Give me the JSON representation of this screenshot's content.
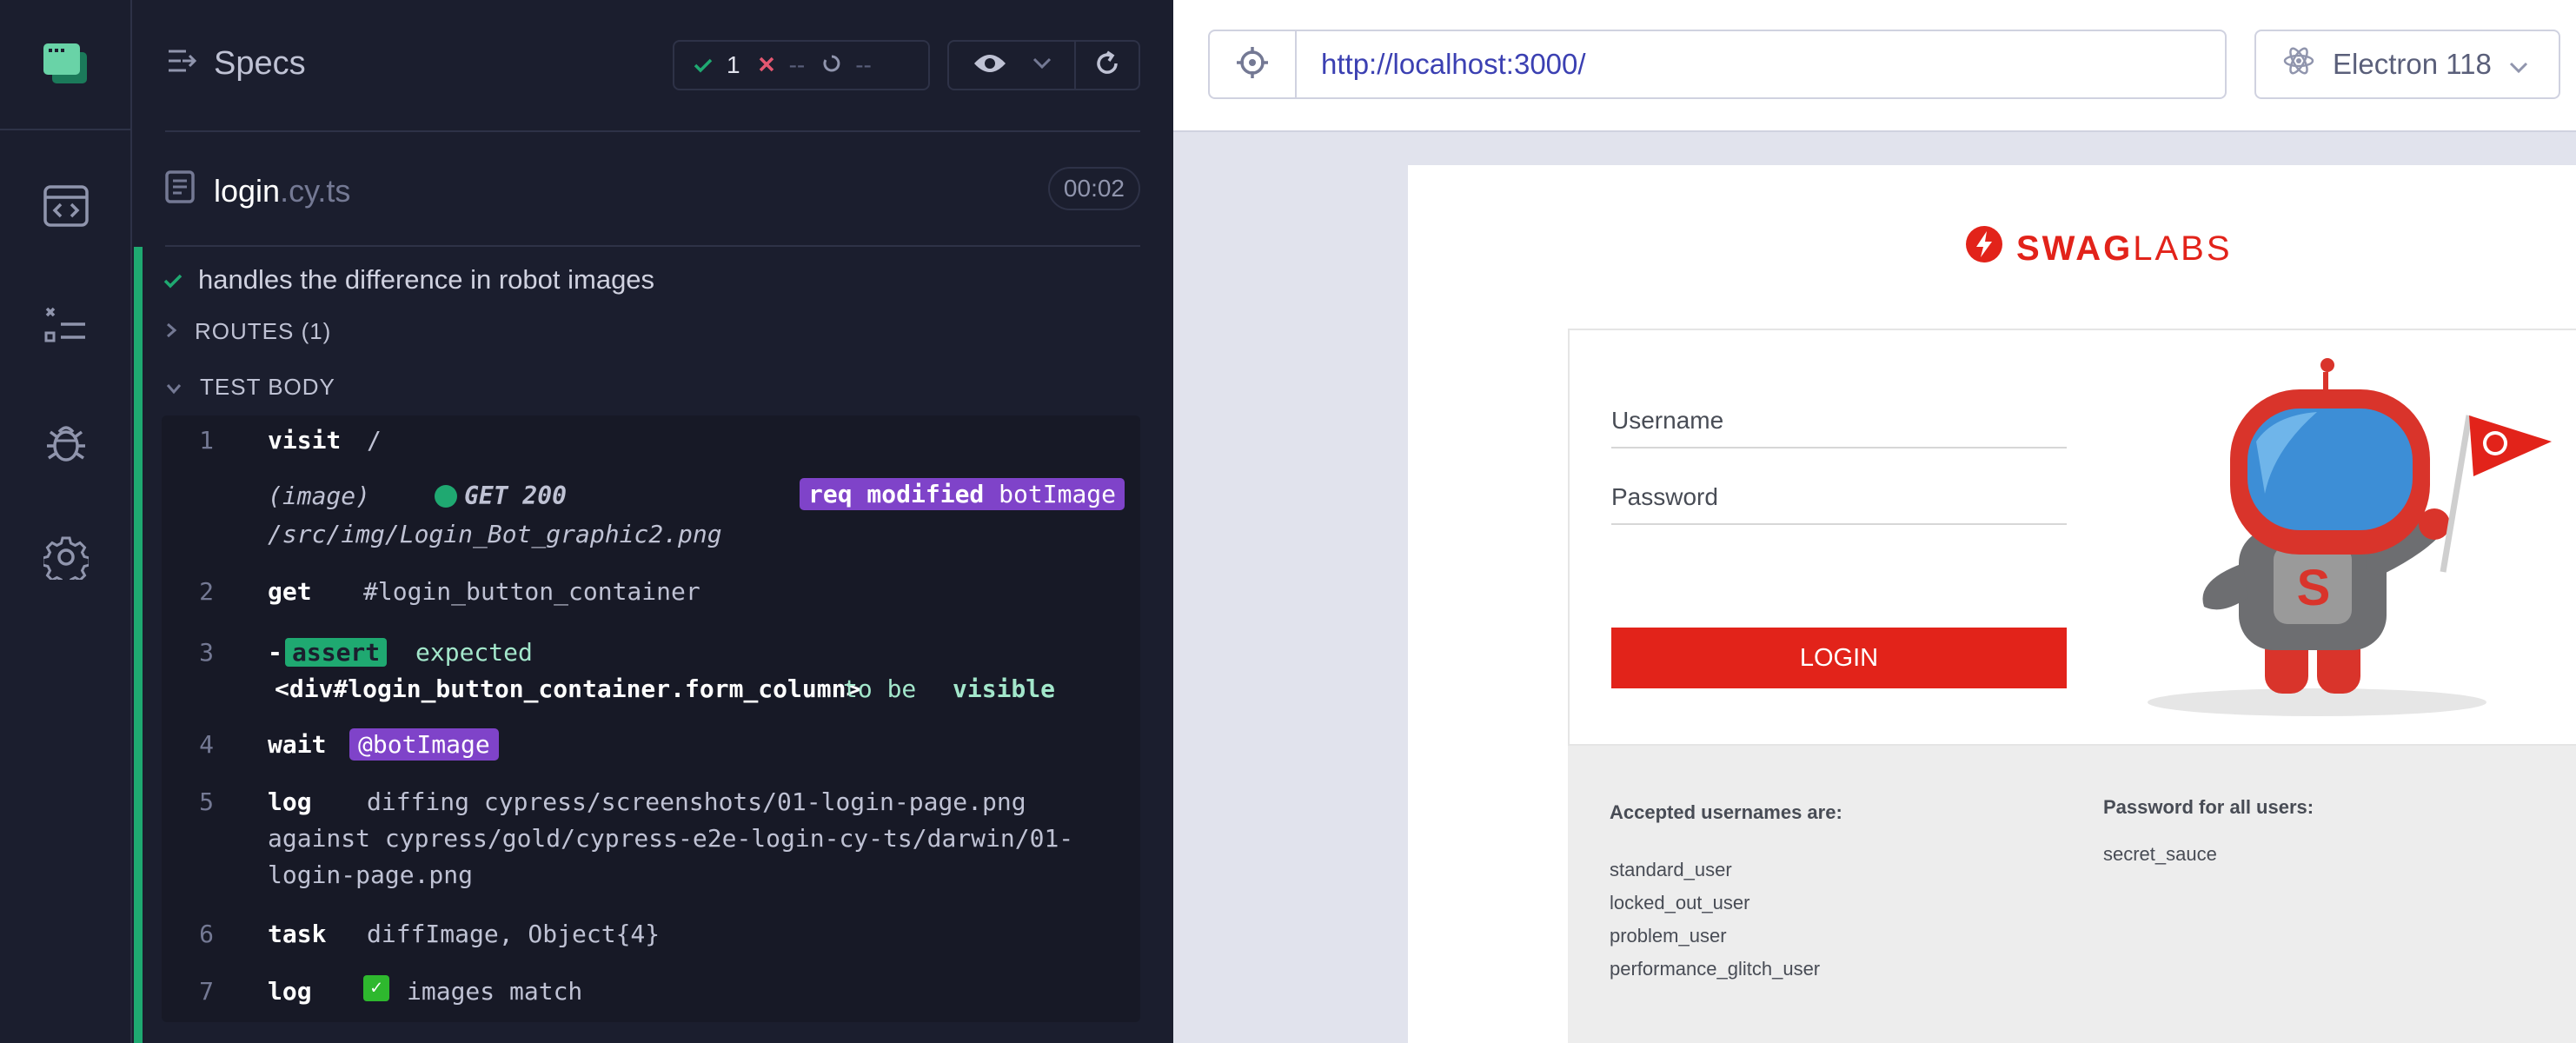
{
  "specs_panel": {
    "title": "Specs",
    "stats": {
      "passed": "1",
      "failed": "--",
      "pending": "--"
    },
    "file": {
      "name": "login",
      "ext": ".cy.ts",
      "duration": "00:02"
    },
    "test_title": "handles the difference in robot images",
    "routes_label": "ROUTES (1)",
    "body_label": "TEST BODY",
    "commands": [
      {
        "num": "1",
        "name": "visit",
        "message": "/"
      },
      {
        "num": "",
        "prefix": "(image)",
        "method_status": "GET 200",
        "path": "/src/img/Login_Bot_graphic2.png",
        "badge_bold": "req modified",
        "badge_alias": "botImage"
      },
      {
        "num": "2",
        "name": "get",
        "message": "#login_button_container"
      },
      {
        "num": "3",
        "name": "-",
        "badge": "assert",
        "line1": "expected",
        "element": "<div#login_button_container.form_column>",
        "to_be": "to be",
        "visible": "visible"
      },
      {
        "num": "4",
        "name": "wait",
        "alias": "@botImage"
      },
      {
        "num": "5",
        "name": "log",
        "message_lines": [
          "diffing cypress/screenshots/01-login-page.png",
          "against cypress/gold/cypress-e2e-login-cy-ts/darwin/01-",
          "login-page.png"
        ]
      },
      {
        "num": "6",
        "name": "task",
        "message": "diffImage, Object{4}"
      },
      {
        "num": "7",
        "name": "log",
        "emoji": "✅",
        "message": "images match"
      }
    ]
  },
  "aut": {
    "url": "http://localhost:3000/",
    "browser": "Electron 118",
    "page": {
      "logo_swag": "SWAG",
      "logo_labs": "LABS",
      "username_placeholder": "Username",
      "password_placeholder": "Password",
      "login_button": "LOGIN",
      "accepted_heading": "Accepted usernames are:",
      "usernames": [
        "standard_user",
        "locked_out_user",
        "problem_user",
        "performance_glitch_user"
      ],
      "password_heading": "Password for all users:",
      "password_value": "secret_sauce"
    }
  },
  "colors": {
    "pass": "#1fa971",
    "fail": "#e45770",
    "accent_purple": "#7f43c9",
    "brand_red": "#e2231a",
    "link_blue": "#3b40b2"
  },
  "icons": [
    "cypress-logo-icon",
    "specs-list-icon",
    "runs-icon",
    "code-icon",
    "debug-bug-icon",
    "settings-gear-icon",
    "check-icon",
    "x-icon",
    "spinner-icon",
    "eye-icon",
    "chevron-down-icon",
    "reload-icon",
    "file-icon",
    "crosshair-icon",
    "electron-icon"
  ]
}
